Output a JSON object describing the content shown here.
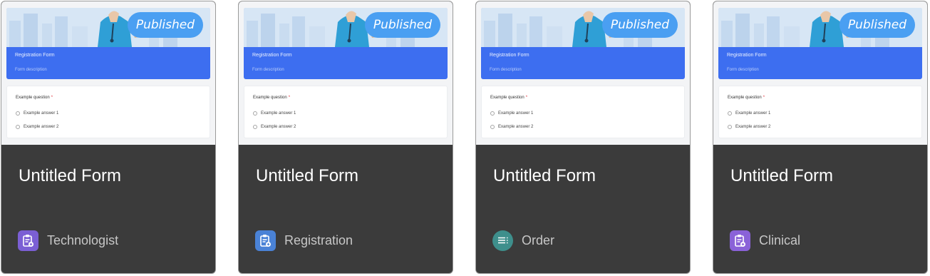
{
  "preview": {
    "published_badge": "Published",
    "banner_title": "Registration Form",
    "banner_description": "Form description",
    "question_label": "Example question",
    "required_marker": "*",
    "options": [
      "Example answer 1",
      "Example answer 2"
    ]
  },
  "cards": [
    {
      "title": "Untitled Form",
      "type_label": "Technologist",
      "icon_name": "clipboard-icon",
      "icon_color": "#7b5fd4",
      "icon_shape": "rounded-square"
    },
    {
      "title": "Untitled Form",
      "type_label": "Registration",
      "icon_name": "clipboard-icon",
      "icon_color": "#4a82d6",
      "icon_shape": "rounded-square"
    },
    {
      "title": "Untitled Form",
      "type_label": "Order",
      "icon_name": "list-icon",
      "icon_color": "#3e8f8c",
      "icon_shape": "circle"
    },
    {
      "title": "Untitled Form",
      "type_label": "Clinical",
      "icon_name": "clipboard-icon",
      "icon_color": "#8a62d8",
      "icon_shape": "rounded-square"
    }
  ],
  "colors": {
    "card_background": "#3b3b3b",
    "banner_blue": "#3d6ef0",
    "badge_blue": "#4a9ff2"
  }
}
